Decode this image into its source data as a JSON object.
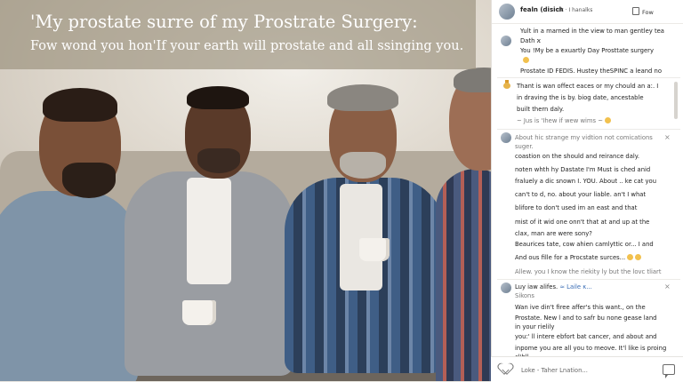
{
  "photo": {
    "title": "'My  prostate surre  of my Prostrate Surgery:",
    "subtitle": "Fow wond you hon'If your earth will prostate and all ssinging you."
  },
  "sidebar": {
    "header": {
      "name": "fealn (disich",
      "sub": "ck · I hanalks",
      "follow_label": "Fow",
      "avatar_icon": "user-avatar-icon"
    },
    "comments": [
      {
        "lines": [
          "Yult in a marned in the view to man gentley tea",
          "Dath ϰ",
          "You !My be a exuartly Day  Prosttate surgery",
          "Prostate ID FEDIS.  Hustey theSPINC a leand no"
        ]
      },
      {
        "lines": [
          "Thant is wan offect eaces or my chould an a:. I",
          "in draving the is by.  biog date, ancestable",
          "built thern daly."
        ],
        "meta": "~ Jus is 'Ihew if wew wims ~"
      },
      {
        "lines": [
          "About hic strange my vidtion not comications",
          "suger.",
          "coastion on the should and reirance daly.",
          "noten whth hy Dastate I'm Must is ched anid",
          "fraluely a dic snown I. YOU. About .. ke cat you",
          "can't to d, no. about your liable. an't I what",
          "blifore to don't used im an east and that",
          "mist of it wid one onn't that at and up at the",
          "clax, man are were sony?",
          "Beaurices tate, cow ahien camlyttic or... I and",
          "And ous fille for a Procstate surces..."
        ],
        "meta": "Allew.  you I know the riekity ly but the lovc tliart"
      },
      {
        "author": "Luy iaw alifes.",
        "author_tag": "≈ Laile κ...",
        "author_sub": "Sikons",
        "lines": [
          "Wan ive din't firee affer's this want., on the",
          "Prostate.  New l and to safr bu none gease land",
          "in your rielily",
          "you:' ll intere ebfort bat cancer, and about and",
          "inpome you are all you to meove. It'l like is proing",
          "cl'bll..."
        ]
      }
    ],
    "footer": {
      "placeholder": "Loke - Taher Lnation...",
      "like_icon": "heart-icon",
      "comment_icon": "chat-bubble-icon"
    }
  }
}
